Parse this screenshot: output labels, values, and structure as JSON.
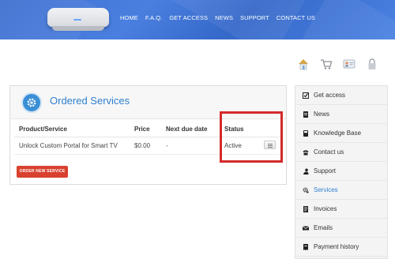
{
  "header": {
    "nav": [
      "HOME",
      "F.A.Q.",
      "GET ACCESS",
      "NEWS",
      "SUPPORT",
      "CONTACT US"
    ]
  },
  "top_icons": [
    "home-icon",
    "cart-icon",
    "contact-card-icon",
    "lock-icon"
  ],
  "panel": {
    "title": "Ordered Services",
    "columns": [
      "Product/Service",
      "Price",
      "Next due date",
      "Status"
    ],
    "rows": [
      {
        "product": "Unlock Custom Portal for Smart TV",
        "price": "$0.00",
        "due": "-",
        "status": "Active"
      }
    ],
    "order_button": "ORDER NEW SERVICE"
  },
  "sidebar": {
    "items": [
      {
        "label": "Get access",
        "icon": "checkbox-icon"
      },
      {
        "label": "News",
        "icon": "document-icon"
      },
      {
        "label": "Knowledge Base",
        "icon": "book-icon"
      },
      {
        "label": "Contact us",
        "icon": "phone-icon"
      },
      {
        "label": "Support",
        "icon": "person-icon"
      },
      {
        "label": "Services",
        "icon": "gear-icon",
        "active": true
      },
      {
        "label": "Invoices",
        "icon": "invoice-icon"
      },
      {
        "label": "Emails",
        "icon": "envelope-icon"
      },
      {
        "label": "Payment history",
        "icon": "receipt-icon"
      }
    ]
  },
  "colors": {
    "header": "#3d6fd0",
    "accent": "#2f7fd0",
    "order_button": "#d9412f",
    "highlight": "#d42a2a"
  }
}
